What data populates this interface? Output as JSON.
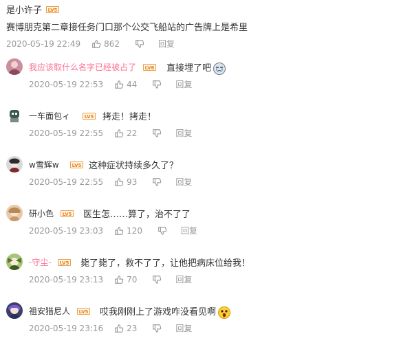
{
  "main_comment": {
    "username": "是小许子",
    "level": "LV5",
    "text": "赛博朋克第二章接任务门口那个公交飞船站的广告牌上是希里",
    "time": "2020-05-19 22:49",
    "likes": "862",
    "reply_label": "回复"
  },
  "replies": [
    {
      "username": "我应该取什么名字已经被占了",
      "level": "LV6",
      "text": "直接埋了吧",
      "time": "2020-05-19 22:53",
      "likes": "44",
      "reply_label": "回复",
      "emoji": "crying-face-icon"
    },
    {
      "username": "一车面包ィ",
      "level": "LV5",
      "text": "拷走！拷走！",
      "time": "2020-05-19 22:55",
      "likes": "22",
      "reply_label": "回复"
    },
    {
      "username": "w雪辉w",
      "level": "LV5",
      "text": "这种症状持续多久了？",
      "time": "2020-05-19 22:55",
      "likes": "93",
      "reply_label": "回复"
    },
    {
      "username": "研小色",
      "level": "LV5",
      "text": "医生怎……算了，治不了了",
      "time": "2020-05-19 23:03",
      "likes": "120",
      "reply_label": "回复"
    },
    {
      "username": "-守尘-",
      "level": "LV5",
      "text": "毙了毙了，救不了了，让他把病床位给我！",
      "time": "2020-05-19 23:13",
      "likes": "70",
      "reply_label": "回复"
    },
    {
      "username": "祖安猎尼人",
      "level": "LV5",
      "text": "哎我刚刚上了游戏咋没看见啊",
      "time": "2020-05-19 23:16",
      "likes": "23",
      "reply_label": "回复",
      "emoji": "shocked-face-icon"
    }
  ],
  "colors": {
    "username_special": "#fb7299",
    "meta": "#999999",
    "level_border": "#e7a14a"
  }
}
